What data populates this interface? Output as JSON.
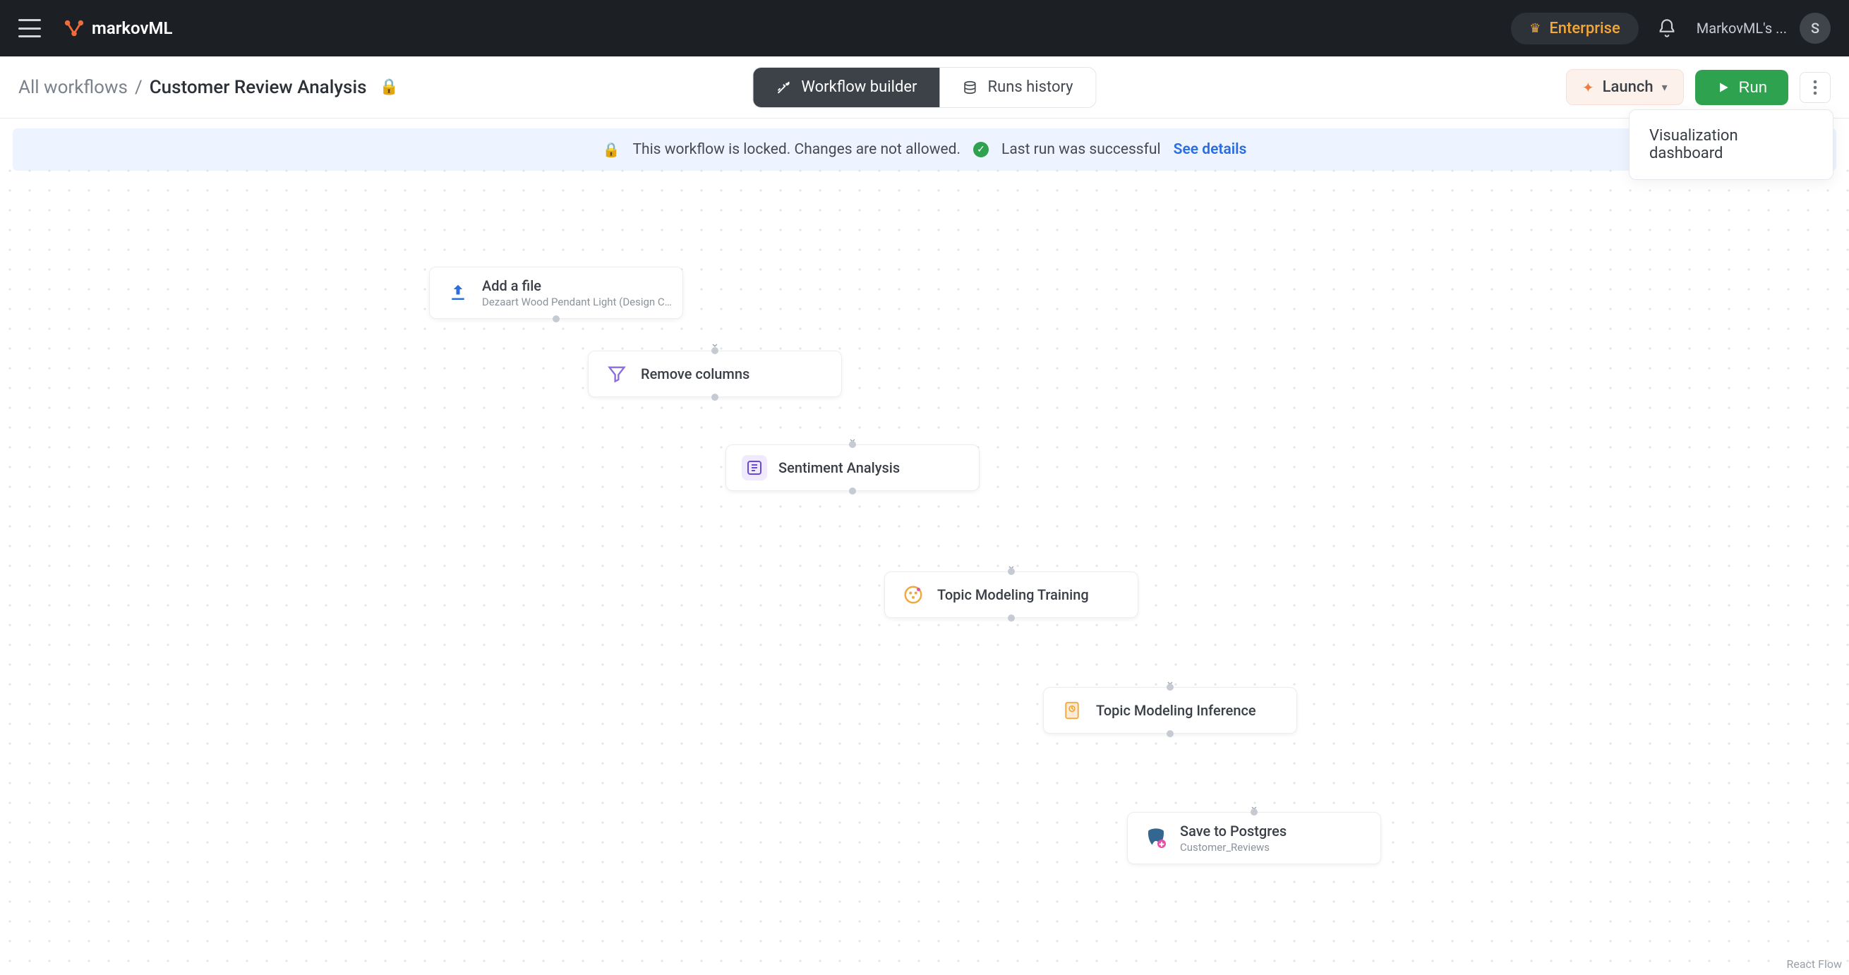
{
  "brand": {
    "name": "markovML"
  },
  "top": {
    "enterprise_label": "Enterprise",
    "org_label": "MarkovML's ...",
    "avatar_letter": "S"
  },
  "breadcrumb": {
    "root": "All workflows",
    "separator": "/",
    "leaf": "Customer Review Analysis"
  },
  "tabs": {
    "builder": "Workflow builder",
    "history": "Runs history"
  },
  "actions": {
    "launch": "Launch",
    "run": "Run",
    "popover_item": "Visualization dashboard"
  },
  "banner": {
    "locked_msg": "This workflow is locked. Changes are not allowed.",
    "last_run_msg": "Last run was successful",
    "see_details": "See details"
  },
  "nodes": {
    "n1": {
      "title": "Add a file",
      "subtitle": "Dezaart Wood Pendant Light (Design Company) - ..."
    },
    "n2": {
      "title": "Remove columns"
    },
    "n3": {
      "title": "Sentiment Analysis"
    },
    "n4": {
      "title": "Topic Modeling Training"
    },
    "n5": {
      "title": "Topic Modeling Inference"
    },
    "n6": {
      "title": "Save to Postgres",
      "subtitle": "Customer_Reviews"
    }
  },
  "footer": {
    "attribution": "React Flow"
  }
}
